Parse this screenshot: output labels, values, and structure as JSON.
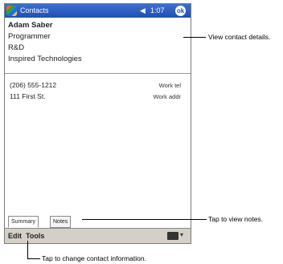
{
  "app": {
    "title": "Contacts",
    "clock": "1:07",
    "speaker_icon": "speaker-icon",
    "ok_label": "ok"
  },
  "contact": {
    "name": "Adam Saber",
    "title": "Programmer",
    "department": "R&D",
    "company": "Inspired Technologies",
    "entries": [
      {
        "value": "(206) 555-1212",
        "label": "Work tel"
      },
      {
        "value": "111 First St.",
        "label": "Work addr"
      }
    ]
  },
  "tabs": [
    {
      "label": "Summary"
    },
    {
      "label": "Notes"
    }
  ],
  "menu": {
    "edit": "Edit",
    "tools": "Tools"
  },
  "callouts": {
    "details": "View contact details.",
    "notes": "Tap to view notes.",
    "edit": "Tap to change contact information."
  }
}
